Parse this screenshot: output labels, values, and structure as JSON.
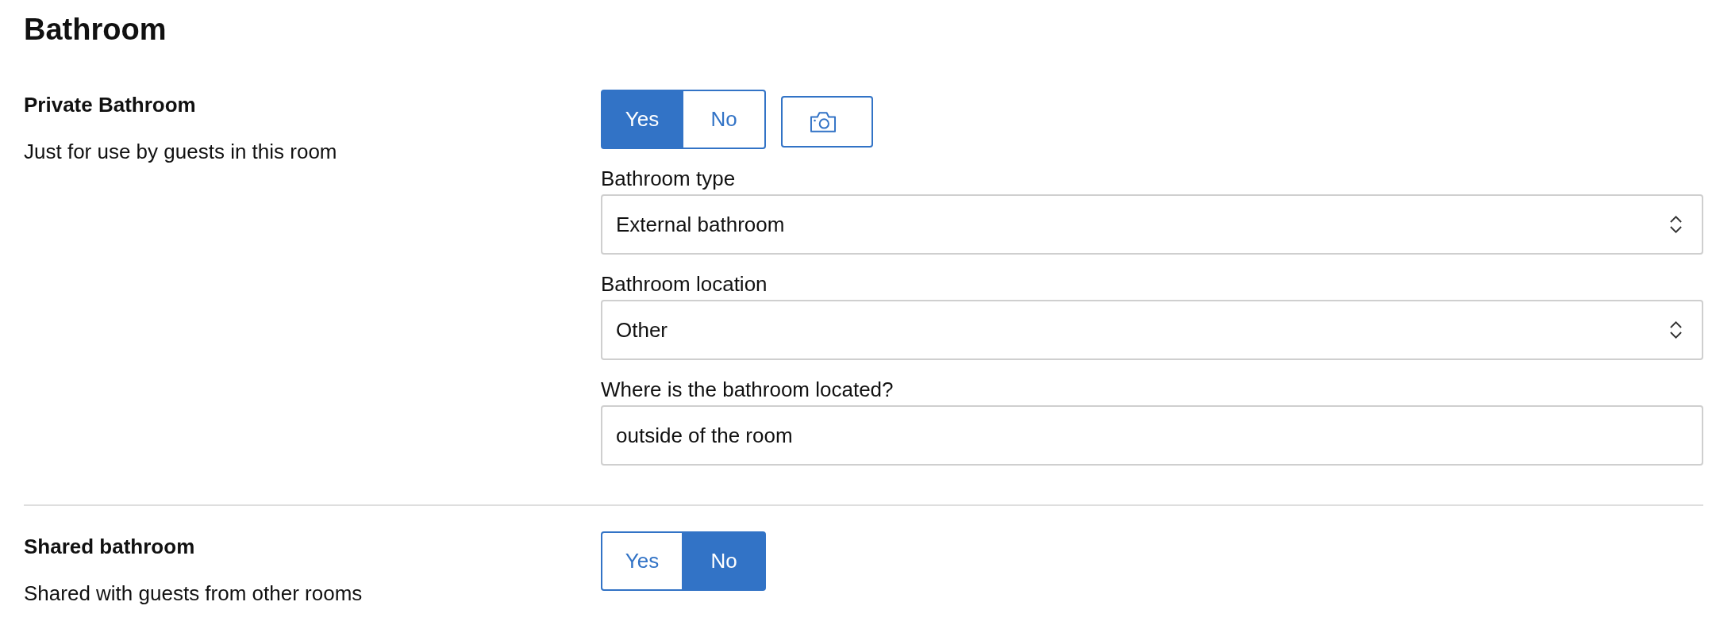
{
  "heading": "Bathroom",
  "sections": [
    {
      "title": "Private Bathroom",
      "description": "Just for use by guests in this room",
      "options": [
        {
          "label": "Yes",
          "selected": true
        },
        {
          "label": "No",
          "selected": false
        }
      ],
      "actions": [
        {
          "kind": "photo"
        }
      ],
      "fields": [
        {
          "kind": "select",
          "label": "Bathroom type",
          "value": "External bathroom"
        },
        {
          "kind": "select",
          "label": "Bathroom location",
          "value": "Other"
        },
        {
          "kind": "text",
          "label": "Where is the bathroom located?",
          "value": "outside of the room"
        }
      ]
    },
    {
      "title": "Shared bathroom",
      "description": "Shared with guests from other rooms",
      "options": [
        {
          "label": "Yes",
          "selected": false
        },
        {
          "label": "No",
          "selected": true
        }
      ]
    }
  ]
}
